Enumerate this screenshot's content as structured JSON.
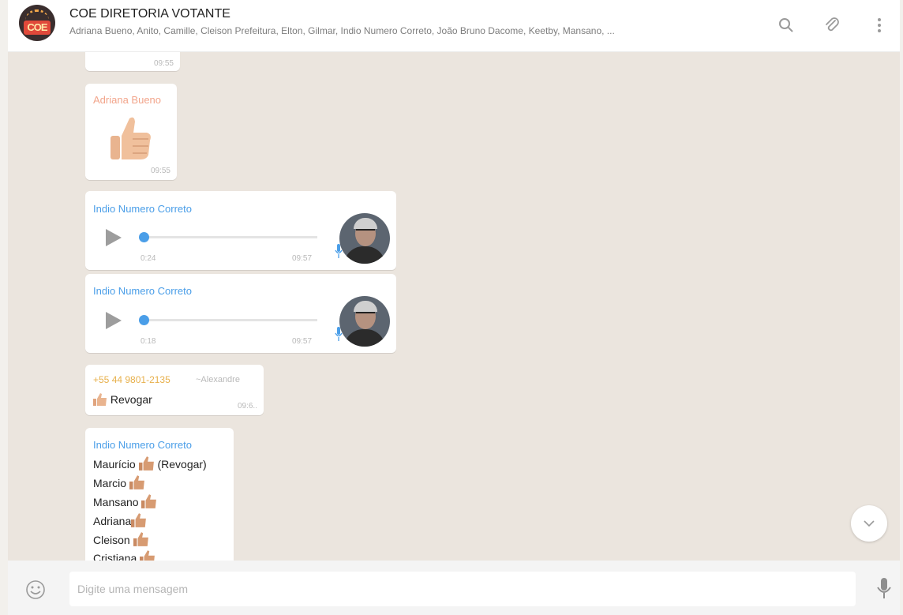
{
  "header": {
    "title": "COE DIRETORIA VOTANTE",
    "members": "Adriana Bueno, Anito, Camille, Cleison Prefeitura, Elton, Gilmar, Indio Numero Correto, João Bruno Dacome, Keetby, Mansano, ...",
    "avatar_text": "COE",
    "icons": [
      "search-icon",
      "attach-icon",
      "menu-icon"
    ]
  },
  "messages": [
    {
      "id": "partial",
      "time": "09:55"
    },
    {
      "id": "sticker",
      "sender": "Adriana Bueno",
      "sender_color": "#f2a58b",
      "time": "09:55"
    },
    {
      "id": "audio1",
      "sender": "Indio Numero Correto",
      "sender_color": "#4a9ee8",
      "duration": "0:24",
      "time": "09:57"
    },
    {
      "id": "audio2",
      "sender": "Indio Numero Correto",
      "sender_color": "#4a9ee8",
      "duration": "0:18",
      "time": "09:57"
    },
    {
      "id": "reply",
      "sender": "+55 44 9801-2135",
      "sender_color": "#e7b04b",
      "push_name": "~Alexandre",
      "text": "Revogar",
      "time": "09:6.."
    },
    {
      "id": "poll",
      "sender": "Indio Numero Correto",
      "sender_color": "#4a9ee8",
      "lines": [
        {
          "name": "Maurício",
          "suffix": " (Revogar)"
        },
        {
          "name": "Marcio",
          "suffix": ""
        },
        {
          "name": "Mansano",
          "suffix": ""
        },
        {
          "name": "Adriana",
          "suffix": ""
        },
        {
          "name": "Cleison",
          "suffix": ""
        },
        {
          "name": "Cristiana",
          "suffix": ""
        }
      ]
    }
  ],
  "composer": {
    "placeholder": "Digite uma mensagem"
  },
  "colors": {
    "chat_bg": "#ebe5de",
    "accent_blue": "#4a9ee8",
    "thumb": "#e9b48f"
  }
}
